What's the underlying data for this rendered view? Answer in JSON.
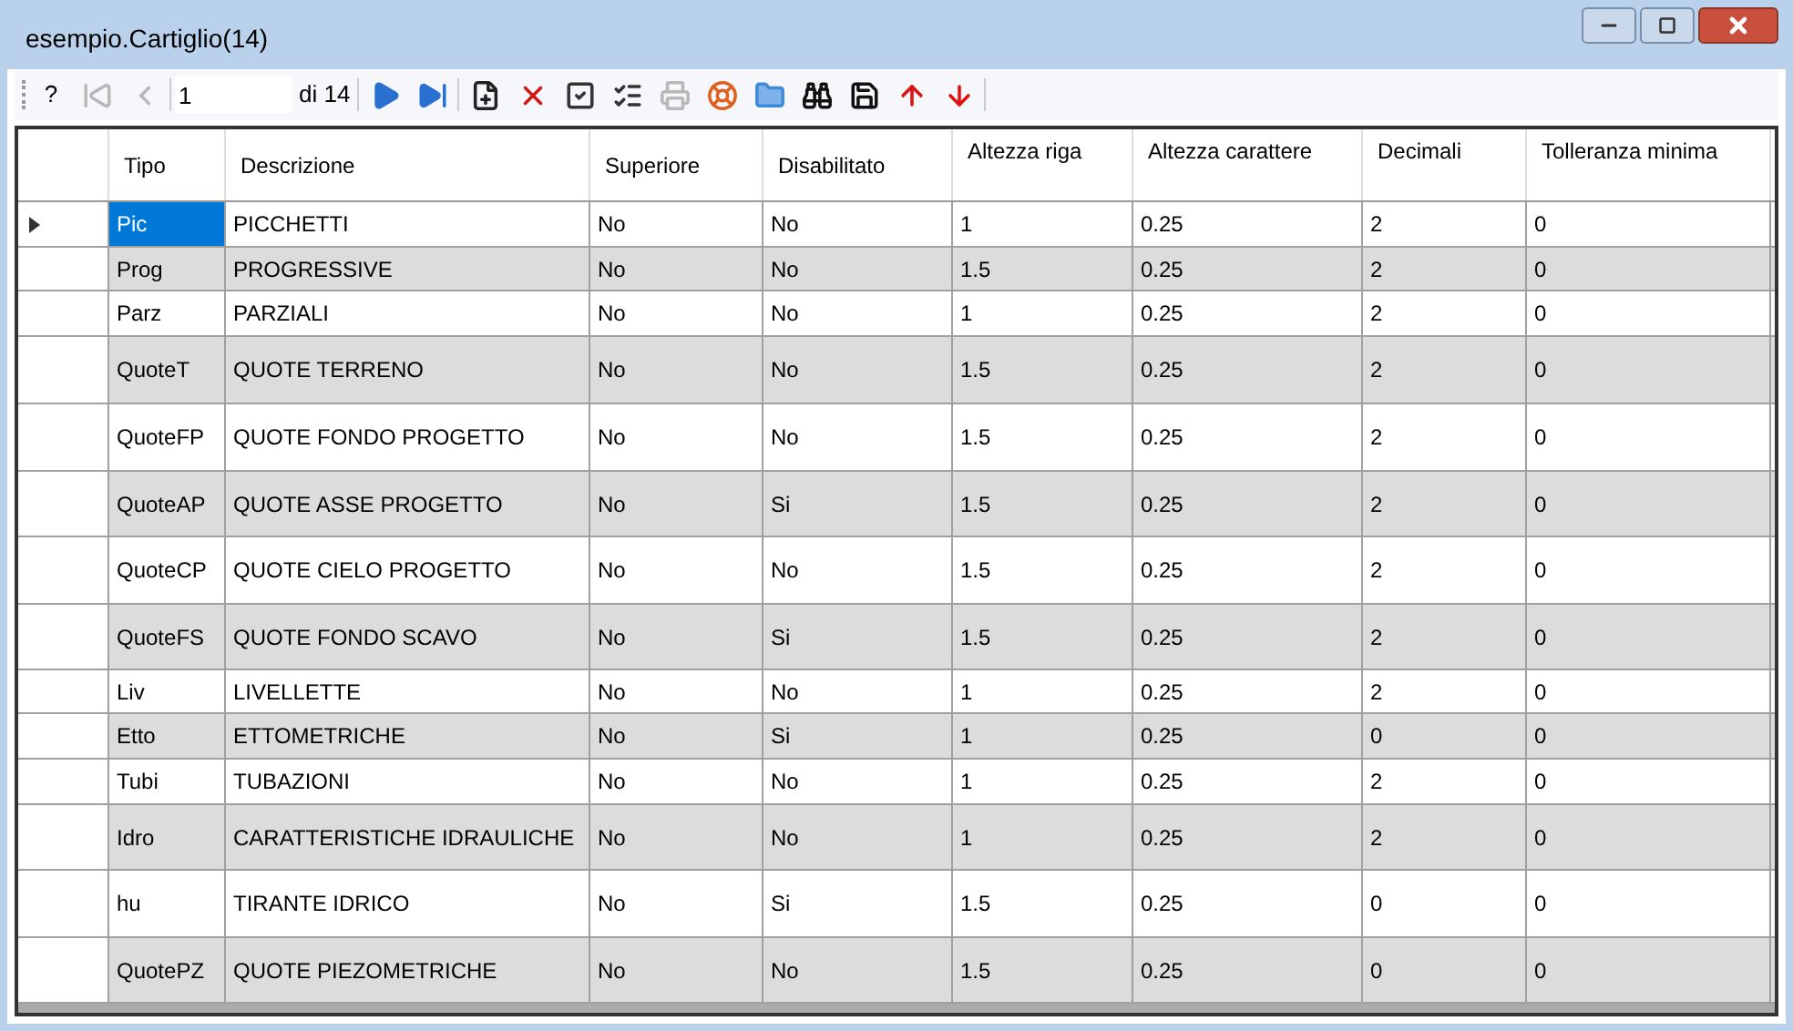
{
  "window": {
    "title": "esempio.Cartiglio(14)"
  },
  "toolbar": {
    "help": "?",
    "nav_before": [
      {
        "disabled": true
      },
      {
        "disabled": true
      }
    ],
    "page": "1",
    "page_count": "di 14",
    "nav_after": [
      {
        "disabled": false
      },
      {
        "disabled": false
      }
    ],
    "actions": [
      {
        "disabled": false
      },
      {
        "disabled": false
      },
      {
        "disabled": false
      },
      {
        "disabled": false
      },
      {
        "disabled": true
      },
      {
        "disabled": false
      },
      {
        "disabled": false
      },
      {
        "disabled": false
      },
      {
        "disabled": false
      },
      {
        "disabled": false
      },
      {
        "disabled": false
      }
    ]
  },
  "table": {
    "columns": [
      "Tipo",
      "Descrizione",
      "Superiore",
      "Disabilitato",
      "Altezza riga",
      "Altezza carattere",
      "Decimali",
      "Tolleranza minima"
    ],
    "rows": [
      {
        "selected": true,
        "cells": [
          "Pic",
          "PICCHETTI",
          "No",
          "No",
          "1",
          "0.25",
          "2",
          "0"
        ]
      },
      {
        "selected": false,
        "cells": [
          "Prog",
          "PROGRESSIVE",
          "No",
          "No",
          "1.5",
          "0.25",
          "2",
          "0"
        ]
      },
      {
        "selected": false,
        "cells": [
          "Parz",
          "PARZIALI",
          "No",
          "No",
          "1",
          "0.25",
          "2",
          "0"
        ]
      },
      {
        "selected": false,
        "cells": [
          "QuoteT",
          "QUOTE TERRENO",
          "No",
          "No",
          "1.5",
          "0.25",
          "2",
          "0"
        ]
      },
      {
        "selected": false,
        "cells": [
          "QuoteFP",
          "QUOTE FONDO PROGETTO",
          "No",
          "No",
          "1.5",
          "0.25",
          "2",
          "0"
        ]
      },
      {
        "selected": false,
        "cells": [
          "QuoteAP",
          "QUOTE ASSE PROGETTO",
          "No",
          "Si",
          "1.5",
          "0.25",
          "2",
          "0"
        ]
      },
      {
        "selected": false,
        "cells": [
          "QuoteCP",
          "QUOTE CIELO PROGETTO",
          "No",
          "No",
          "1.5",
          "0.25",
          "2",
          "0"
        ]
      },
      {
        "selected": false,
        "cells": [
          "QuoteFS",
          "QUOTE FONDO SCAVO",
          "No",
          "Si",
          "1.5",
          "0.25",
          "2",
          "0"
        ]
      },
      {
        "selected": false,
        "cells": [
          "Liv",
          "LIVELLETTE",
          "No",
          "No",
          "1",
          "0.25",
          "2",
          "0"
        ]
      },
      {
        "selected": false,
        "cells": [
          "Etto",
          "ETTOMETRICHE",
          "No",
          "Si",
          "1",
          "0.25",
          "0",
          "0"
        ]
      },
      {
        "selected": false,
        "cells": [
          "Tubi",
          "TUBAZIONI",
          "No",
          "No",
          "1",
          "0.25",
          "2",
          "0"
        ]
      },
      {
        "selected": false,
        "cells": [
          "Idro",
          "CARATTERISTICHE IDRAULICHE",
          "No",
          "No",
          "1",
          "0.25",
          "2",
          "0"
        ]
      },
      {
        "selected": false,
        "cells": [
          "hu",
          "TIRANTE IDRICO",
          "No",
          "Si",
          "1.5",
          "0.25",
          "0",
          "0"
        ]
      },
      {
        "selected": false,
        "cells": [
          "QuotePZ",
          "QUOTE PIEZOMETRICHE",
          "No",
          "No",
          "1.5",
          "0.25",
          "0",
          "0"
        ]
      }
    ]
  }
}
